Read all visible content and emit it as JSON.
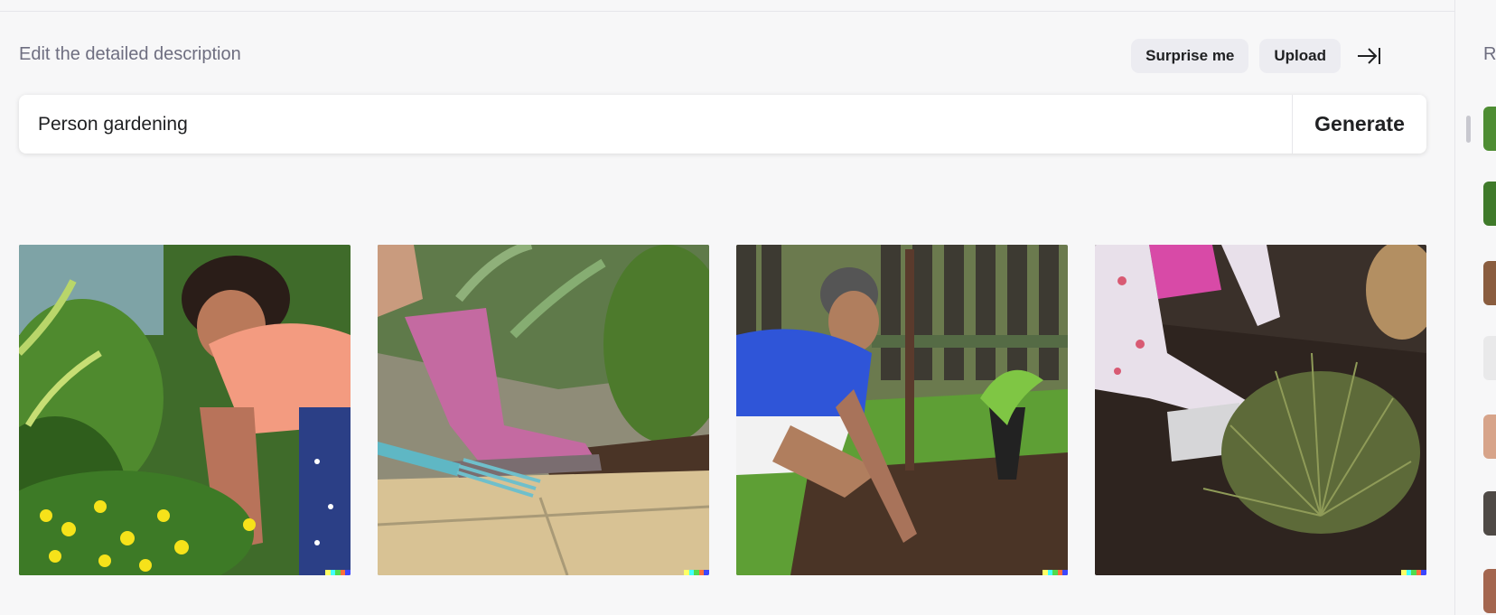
{
  "header": {
    "label": "Edit the detailed description",
    "surprise_label": "Surprise me",
    "upload_label": "Upload",
    "collapse_icon": "arrow-right-to-line-icon"
  },
  "prompt": {
    "value": "Person gardening",
    "generate_label": "Generate"
  },
  "results": [
    {
      "description_icon": "woman-planting-flowers-image"
    },
    {
      "description_icon": "pink-boot-garden-fork-image"
    },
    {
      "description_icon": "man-planting-stake-image"
    },
    {
      "description_icon": "planting-grass-soil-image"
    }
  ],
  "signature_colors": [
    "#ffff66",
    "#42ffff",
    "#51da4c",
    "#ff6e3c",
    "#3c46ff"
  ],
  "recent": {
    "heading": "R"
  }
}
